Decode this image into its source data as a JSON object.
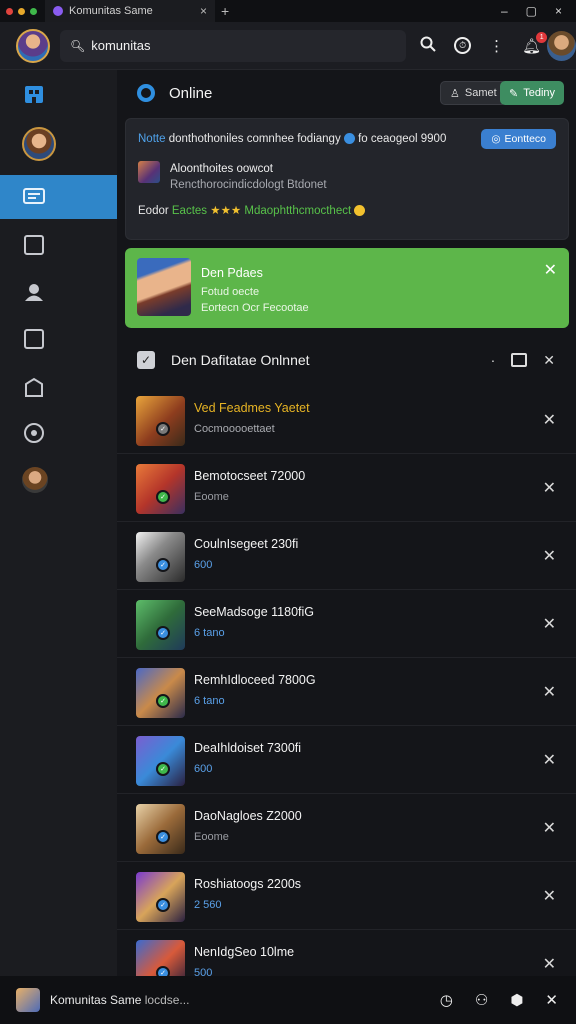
{
  "window": {
    "tab_title": "Komunitas Same",
    "tab_close": "×",
    "new_tab": "+",
    "controls": [
      "–",
      "▢",
      "×"
    ]
  },
  "topbar": {
    "search_value": "komunitas",
    "notification_count": "1"
  },
  "sidebar": {
    "items": [
      "building-icon",
      "profile-avatar",
      "chat-icon",
      "edit-icon",
      "user-icon",
      "document-icon",
      "share-icon",
      "settings-icon",
      "avatar-small"
    ],
    "active_index": 2
  },
  "main": {
    "title": "Online",
    "pill_1": "Samet",
    "pill_2": "Tediny",
    "card": {
      "line1_prefix": "Notte",
      "line1_text": "donthothoniles comnhee fodiangy",
      "line1_suffix": "fo ceaogeol 9900",
      "button_label": "Eontteco",
      "line2_title": "Aloonthoites oowcot",
      "line2_sub": "Rencthorocindicdologt Btdonet",
      "line3_prefix": "Eodor",
      "line3_green": "Eactes",
      "line3_stars": "★★★",
      "line3_text": "Mdaophtthcmocthect"
    },
    "highlight": {
      "name": "Den Pdaes",
      "line2": "Fotud oecte",
      "line3": "Eortecn Ocr Fecootae"
    },
    "list_title": "Den Dafitatae Onlnnet",
    "items": [
      {
        "title": "Ved Feadmes Yaetet",
        "sub": "Cocmooooettaet",
        "title_color": "#e6b324",
        "sub_color": "#a9abb0"
      },
      {
        "title": "Bemotocseet 72000",
        "sub": "Eoome",
        "title_color": "#f3f3f3",
        "sub_color": "#9a9ca2"
      },
      {
        "title": "CoulnIsegeet 230fi",
        "sub": "600",
        "title_color": "#f3f3f3",
        "sub_color": "#5aa0e8"
      },
      {
        "title": "SeeMadsoge 1180fiG",
        "sub": "6 tano",
        "title_color": "#f3f3f3",
        "sub_color": "#5aa0e8"
      },
      {
        "title": "RemhIdloceed 7800G",
        "sub": "6 tano",
        "title_color": "#f3f3f3",
        "sub_color": "#5aa0e8"
      },
      {
        "title": "DeaIhldoiset 7300fi",
        "sub": "600",
        "title_color": "#f3f3f3",
        "sub_color": "#5aa0e8"
      },
      {
        "title": "DaoNagloes Z2000",
        "sub": "Eoome",
        "title_color": "#f3f3f3",
        "sub_color": "#9a9ca2"
      },
      {
        "title": "Roshiatoogs 2200s",
        "sub": "2 560",
        "title_color": "#f3f3f3",
        "sub_color": "#5aa0e8"
      },
      {
        "title": "NenIdgSeo 10lme",
        "sub": "500",
        "title_color": "#f3f3f3",
        "sub_color": "#5aa0e8"
      }
    ]
  },
  "bottombar": {
    "title": "Komunitas Same",
    "suffix": "locdse..."
  }
}
